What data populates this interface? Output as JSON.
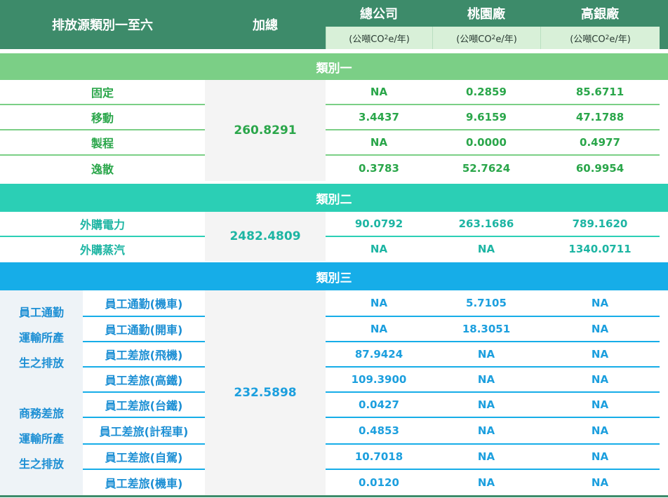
{
  "header": {
    "col_source": "排放源類別一至六",
    "col_total": "加總",
    "col_hq": "總公司",
    "col_taoyuan": "桃園廠",
    "col_kaohsiung": "高銀廠",
    "unit_prefix": "(公噸CO",
    "unit_sub": "2",
    "unit_suffix": "e/年)"
  },
  "category1": {
    "title": "類別一",
    "total": "260.8291",
    "rows": [
      {
        "label": "固定",
        "hq": "NA",
        "taoyuan": "0.2859",
        "kaohsiung": "85.6711"
      },
      {
        "label": "移動",
        "hq": "3.4437",
        "taoyuan": "9.6159",
        "kaohsiung": "47.1788"
      },
      {
        "label": "製程",
        "hq": "NA",
        "taoyuan": "0.0000",
        "kaohsiung": "0.4977"
      },
      {
        "label": "逸散",
        "hq": "0.3783",
        "taoyuan": "52.7624",
        "kaohsiung": "60.9954"
      }
    ]
  },
  "category2": {
    "title": "類別二",
    "total": "2482.4809",
    "rows": [
      {
        "label": "外購電力",
        "hq": "90.0792",
        "taoyuan": "263.1686",
        "kaohsiung": "789.1620"
      },
      {
        "label": "外購蒸汽",
        "hq": "NA",
        "taoyuan": "NA",
        "kaohsiung": "1340.0711"
      }
    ]
  },
  "category3": {
    "title": "類別三",
    "total": "232.5898",
    "group_commute": [
      "員工通勤",
      "運輸所產",
      "生之排放"
    ],
    "group_business": [
      "商務差旅",
      "運輸所產",
      "生之排放"
    ],
    "rows": [
      {
        "label": "員工通勤(機車)",
        "hq": "NA",
        "taoyuan": "5.7105",
        "kaohsiung": "NA"
      },
      {
        "label": "員工通勤(開車)",
        "hq": "NA",
        "taoyuan": "18.3051",
        "kaohsiung": "NA"
      },
      {
        "label": "員工差旅(飛機)",
        "hq": "87.9424",
        "taoyuan": "NA",
        "kaohsiung": "NA"
      },
      {
        "label": "員工差旅(高鐵)",
        "hq": "109.3900",
        "taoyuan": "NA",
        "kaohsiung": "NA"
      },
      {
        "label": "員工差旅(台鐵)",
        "hq": "0.0427",
        "taoyuan": "NA",
        "kaohsiung": "NA"
      },
      {
        "label": "員工差旅(計程車)",
        "hq": "0.4853",
        "taoyuan": "NA",
        "kaohsiung": "NA"
      },
      {
        "label": "員工差旅(自駕)",
        "hq": "10.7018",
        "taoyuan": "NA",
        "kaohsiung": "NA"
      },
      {
        "label": "員工差旅(機車)",
        "hq": "0.0120",
        "taoyuan": "NA",
        "kaohsiung": "NA"
      }
    ]
  },
  "colors": {
    "header": "#3d8b6a",
    "category1": "#7bcf86",
    "category2": "#2bcfb5",
    "category3": "#16ade8",
    "value_green": "#2aa64a",
    "value_blue": "#1c9fde"
  }
}
